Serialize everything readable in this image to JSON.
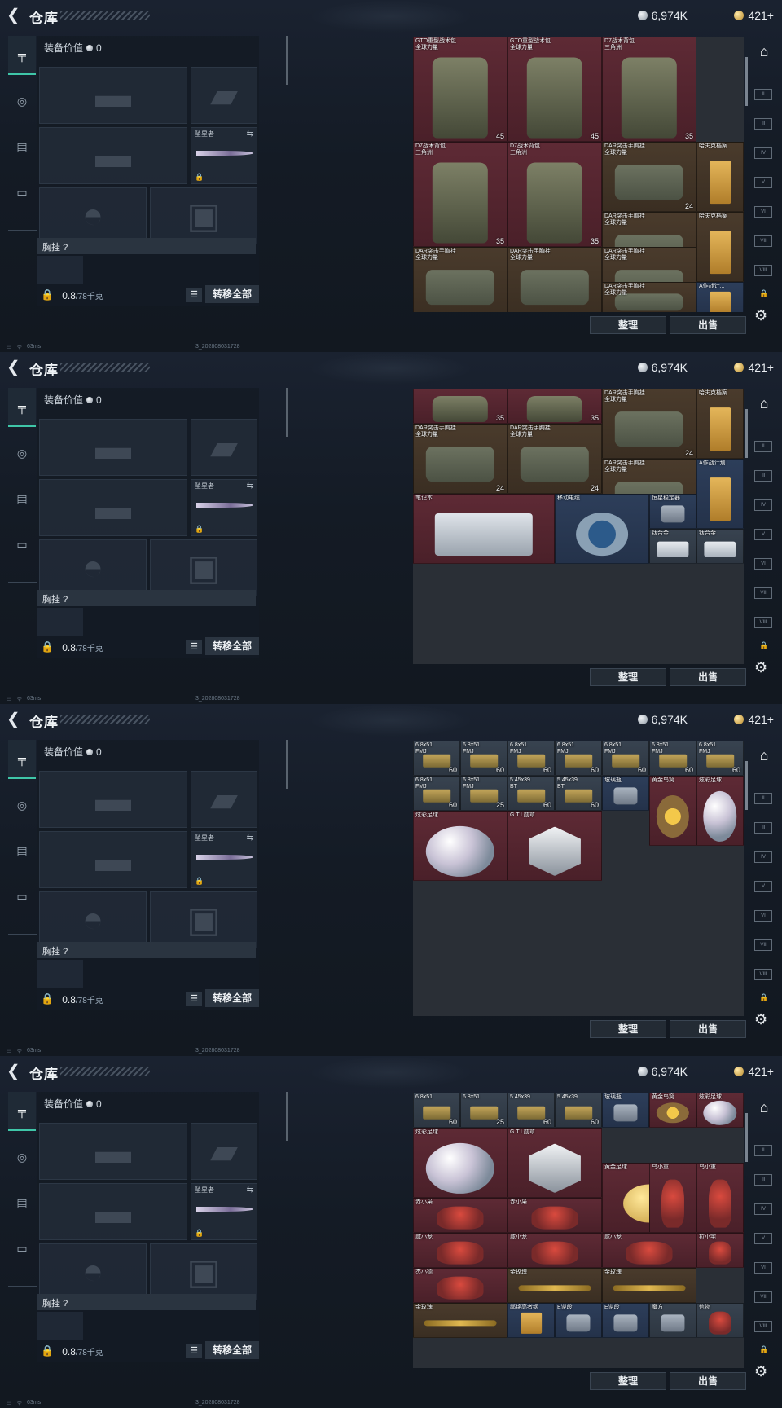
{
  "header": {
    "title": "仓库",
    "silver": "6,974K",
    "gold": "421+"
  },
  "loadout": {
    "equip_value_label": "装备价值",
    "equip_value": "0",
    "knife_label": "坠星者",
    "chest_label": "胸挂",
    "chest_help": "?",
    "weight_current": "0.8",
    "weight_max": "/78千克",
    "transfer_all": "转移全部"
  },
  "inventory_actions": {
    "sort": "整理",
    "sell": "出售"
  },
  "status": {
    "ping": "63ms",
    "build": "3_202808031728"
  },
  "side_tabs": [
    "weapon-tab",
    "helmet-tab",
    "armor-tab",
    "backpack-tab"
  ],
  "screens": [
    {
      "items": [
        {
          "name": "GTO重型战术包\n全球力量",
          "count": "45",
          "kind": "pack",
          "bg": "red",
          "c": 0,
          "r": 0,
          "w": 2,
          "h": 3
        },
        {
          "name": "GTO重型战术包\n全球力量",
          "count": "45",
          "kind": "pack",
          "bg": "red",
          "c": 2,
          "r": 0,
          "w": 2,
          "h": 3
        },
        {
          "name": "D7战术背包\n三角洲",
          "count": "35",
          "kind": "pack",
          "bg": "red",
          "c": 4,
          "r": 0,
          "w": 2,
          "h": 3
        },
        {
          "name": "D7战术背包\n三角洲",
          "count": "35",
          "kind": "pack",
          "bg": "red",
          "c": 0,
          "r": 3,
          "w": 2,
          "h": 3
        },
        {
          "name": "D7战术背包\n三角洲",
          "count": "35",
          "kind": "pack",
          "bg": "red",
          "c": 2,
          "r": 3,
          "w": 2,
          "h": 3
        },
        {
          "name": "DAR突击手胸挂\n全球力量",
          "count": "24",
          "kind": "vest",
          "bg": "brown",
          "c": 4,
          "r": 3,
          "w": 2,
          "h": 2
        },
        {
          "name": "哈夫克档案",
          "count": "",
          "kind": "doc",
          "bg": "brown",
          "c": 6,
          "r": 3,
          "w": 1,
          "h": 2
        },
        {
          "name": "DAR突击手胸挂\n全球力量",
          "count": "24",
          "kind": "vest",
          "bg": "brown",
          "c": 4,
          "r": 5,
          "w": 2,
          "h": 2
        },
        {
          "name": "哈夫克档案",
          "count": "",
          "kind": "doc",
          "bg": "brown",
          "c": 6,
          "r": 5,
          "w": 1,
          "h": 2
        },
        {
          "name": "DAR突击手胸挂\n全球力量",
          "count": "",
          "kind": "vest",
          "bg": "brown",
          "c": 0,
          "r": 6,
          "w": 2,
          "h": 2
        },
        {
          "name": "DAR突击手胸挂\n全球力量",
          "count": "",
          "kind": "vest",
          "bg": "brown",
          "c": 2,
          "r": 6,
          "w": 2,
          "h": 2
        },
        {
          "name": "DAR突击手胸挂\n全球力量",
          "count": "",
          "kind": "vest",
          "bg": "brown",
          "c": 4,
          "r": 6,
          "w": 2,
          "h": 2
        },
        {
          "name": "DAR突击手胸挂\n全球力量",
          "count": "",
          "kind": "vest",
          "bg": "brown",
          "c": 4,
          "r": 7,
          "w": 2,
          "h": 1
        },
        {
          "name": "A作战计...",
          "count": "",
          "kind": "doc",
          "bg": "blue",
          "c": 6,
          "r": 7,
          "w": 1,
          "h": 1
        }
      ]
    },
    {
      "items": [
        {
          "name": "",
          "count": "35",
          "kind": "pack",
          "bg": "red",
          "c": 0,
          "r": 0,
          "w": 2,
          "h": 1
        },
        {
          "name": "",
          "count": "35",
          "kind": "pack",
          "bg": "red",
          "c": 2,
          "r": 0,
          "w": 2,
          "h": 1
        },
        {
          "name": "DAR突击手胸挂\n全球力量",
          "count": "24",
          "kind": "vest",
          "bg": "brown",
          "c": 4,
          "r": 0,
          "w": 2,
          "h": 2
        },
        {
          "name": "哈夫克档案",
          "count": "",
          "kind": "doc",
          "bg": "brown",
          "c": 6,
          "r": 0,
          "w": 1,
          "h": 2
        },
        {
          "name": "DAR突击手胸挂\n全球力量",
          "count": "24",
          "kind": "vest",
          "bg": "brown",
          "c": 0,
          "r": 1,
          "w": 2,
          "h": 2
        },
        {
          "name": "DAR突击手胸挂\n全球力量",
          "count": "24",
          "kind": "vest",
          "bg": "brown",
          "c": 2,
          "r": 1,
          "w": 2,
          "h": 2
        },
        {
          "name": "DAR突击手胸挂\n全球力量",
          "count": "24",
          "kind": "vest",
          "bg": "brown",
          "c": 4,
          "r": 2,
          "w": 2,
          "h": 2
        },
        {
          "name": "A作战计划",
          "count": "",
          "kind": "doc",
          "bg": "blue",
          "c": 6,
          "r": 2,
          "w": 1,
          "h": 2
        },
        {
          "name": "笔记本",
          "count": "",
          "kind": "laptop",
          "bg": "red",
          "c": 0,
          "r": 3,
          "w": 3,
          "h": 2
        },
        {
          "name": "移动电缆",
          "count": "",
          "kind": "reel",
          "bg": "blue",
          "c": 3,
          "r": 3,
          "w": 2,
          "h": 2
        },
        {
          "name": "恒星稳定器",
          "count": "",
          "kind": "small",
          "bg": "blue",
          "c": 5,
          "r": 3,
          "w": 1,
          "h": 1
        },
        {
          "name": "钛合金",
          "count": "",
          "kind": "plate",
          "bg": "gray",
          "c": 5,
          "r": 4,
          "w": 1,
          "h": 1
        },
        {
          "name": "钛合金",
          "count": "",
          "kind": "plate",
          "bg": "gray",
          "c": 6,
          "r": 4,
          "w": 1,
          "h": 1
        }
      ]
    },
    {
      "items": [
        {
          "name": "6.8x51\nFMJ",
          "count": "60",
          "kind": "ammo",
          "bg": "gray",
          "c": 0,
          "r": 0,
          "w": 1,
          "h": 1
        },
        {
          "name": "6.8x51\nFMJ",
          "count": "60",
          "kind": "ammo",
          "bg": "gray",
          "c": 1,
          "r": 0,
          "w": 1,
          "h": 1
        },
        {
          "name": "6.8x51\nFMJ",
          "count": "60",
          "kind": "ammo",
          "bg": "gray",
          "c": 2,
          "r": 0,
          "w": 1,
          "h": 1
        },
        {
          "name": "6.8x51\nFMJ",
          "count": "60",
          "kind": "ammo",
          "bg": "gray",
          "c": 3,
          "r": 0,
          "w": 1,
          "h": 1
        },
        {
          "name": "6.8x51\nFMJ",
          "count": "60",
          "kind": "ammo",
          "bg": "gray",
          "c": 4,
          "r": 0,
          "w": 1,
          "h": 1
        },
        {
          "name": "6.8x51\nFMJ",
          "count": "60",
          "kind": "ammo",
          "bg": "gray",
          "c": 5,
          "r": 0,
          "w": 1,
          "h": 1
        },
        {
          "name": "6.8x51\nFMJ",
          "count": "60",
          "kind": "ammo",
          "bg": "gray",
          "c": 6,
          "r": 0,
          "w": 1,
          "h": 1
        },
        {
          "name": "6.8x51\nFMJ",
          "count": "60",
          "kind": "ammo",
          "bg": "gray",
          "c": 0,
          "r": 1,
          "w": 1,
          "h": 1
        },
        {
          "name": "6.8x51\nFMJ",
          "count": "25",
          "kind": "ammo",
          "bg": "gray",
          "c": 1,
          "r": 1,
          "w": 1,
          "h": 1
        },
        {
          "name": "5.45x39\nBT",
          "count": "60",
          "kind": "ammo",
          "bg": "gray",
          "c": 2,
          "r": 1,
          "w": 1,
          "h": 1
        },
        {
          "name": "5.45x39\nBT",
          "count": "60",
          "kind": "ammo",
          "bg": "gray",
          "c": 3,
          "r": 1,
          "w": 1,
          "h": 1
        },
        {
          "name": "玻璃瓶",
          "count": "",
          "kind": "small",
          "bg": "blue",
          "c": 4,
          "r": 1,
          "w": 1,
          "h": 1
        },
        {
          "name": "黄金鸟窝",
          "count": "",
          "kind": "nest",
          "bg": "red",
          "c": 5,
          "r": 1,
          "w": 1,
          "h": 2
        },
        {
          "name": "炫彩足球",
          "count": "",
          "kind": "orb",
          "bg": "red",
          "c": 6,
          "r": 1,
          "w": 1,
          "h": 2
        },
        {
          "name": "炫彩足球",
          "count": "",
          "kind": "orb",
          "bg": "red",
          "c": 0,
          "r": 2,
          "w": 2,
          "h": 2
        },
        {
          "name": "G.T.I.勋章",
          "count": "",
          "kind": "badge",
          "bg": "red",
          "c": 2,
          "r": 2,
          "w": 2,
          "h": 2
        }
      ]
    },
    {
      "items": [
        {
          "name": "6.8x51",
          "count": "60",
          "kind": "ammo",
          "bg": "gray",
          "c": 0,
          "r": 0,
          "w": 1,
          "h": 1
        },
        {
          "name": "6.8x51",
          "count": "25",
          "kind": "ammo",
          "bg": "gray",
          "c": 1,
          "r": 0,
          "w": 1,
          "h": 1
        },
        {
          "name": "5.45x39",
          "count": "60",
          "kind": "ammo",
          "bg": "gray",
          "c": 2,
          "r": 0,
          "w": 1,
          "h": 1
        },
        {
          "name": "5.45x39",
          "count": "60",
          "kind": "ammo",
          "bg": "gray",
          "c": 3,
          "r": 0,
          "w": 1,
          "h": 1
        },
        {
          "name": "玻璃瓶",
          "count": "",
          "kind": "small",
          "bg": "blue",
          "c": 4,
          "r": 0,
          "w": 1,
          "h": 1
        },
        {
          "name": "黄金鸟窝",
          "count": "",
          "kind": "nest",
          "bg": "red",
          "c": 5,
          "r": 0,
          "w": 1,
          "h": 1
        },
        {
          "name": "炫彩足球",
          "count": "",
          "kind": "orb",
          "bg": "red",
          "c": 6,
          "r": 0,
          "w": 1,
          "h": 1
        },
        {
          "name": "炫彩足球",
          "count": "",
          "kind": "orb",
          "bg": "red",
          "c": 0,
          "r": 1,
          "w": 2,
          "h": 2
        },
        {
          "name": "G.T.I.勋章",
          "count": "",
          "kind": "badge",
          "bg": "red",
          "c": 2,
          "r": 1,
          "w": 2,
          "h": 2
        },
        {
          "name": "黄金足球",
          "count": "",
          "kind": "gold",
          "bg": "red",
          "c": 4,
          "r": 2,
          "w": 2,
          "h": 2
        },
        {
          "name": "乌小重",
          "count": "",
          "kind": "toy",
          "bg": "red",
          "c": 5,
          "r": 2,
          "w": 1,
          "h": 2
        },
        {
          "name": "乌小重",
          "count": "",
          "kind": "toy",
          "bg": "red",
          "c": 6,
          "r": 2,
          "w": 1,
          "h": 2
        },
        {
          "name": "赤小枭",
          "count": "",
          "kind": "toy",
          "bg": "red",
          "c": 0,
          "r": 3,
          "w": 2,
          "h": 1
        },
        {
          "name": "赤小枭",
          "count": "",
          "kind": "toy",
          "bg": "red",
          "c": 2,
          "r": 3,
          "w": 2,
          "h": 1
        },
        {
          "name": "咸小龙",
          "count": "",
          "kind": "toy",
          "bg": "red",
          "c": 0,
          "r": 4,
          "w": 2,
          "h": 1
        },
        {
          "name": "咸小龙",
          "count": "",
          "kind": "toy",
          "bg": "red",
          "c": 2,
          "r": 4,
          "w": 2,
          "h": 1
        },
        {
          "name": "咸小龙",
          "count": "",
          "kind": "toy",
          "bg": "red",
          "c": 4,
          "r": 4,
          "w": 2,
          "h": 1
        },
        {
          "name": "拉小宅",
          "count": "",
          "kind": "toy",
          "bg": "red",
          "c": 6,
          "r": 4,
          "w": 1,
          "h": 1
        },
        {
          "name": "杰小德",
          "count": "",
          "kind": "toy",
          "bg": "red",
          "c": 0,
          "r": 5,
          "w": 2,
          "h": 1
        },
        {
          "name": "金玫瑰",
          "count": "",
          "kind": "rose",
          "bg": "brown",
          "c": 2,
          "r": 5,
          "w": 2,
          "h": 1
        },
        {
          "name": "金玫瑰",
          "count": "",
          "kind": "rose",
          "bg": "brown",
          "c": 4,
          "r": 5,
          "w": 2,
          "h": 1
        },
        {
          "name": "金玫瑰",
          "count": "",
          "kind": "rose",
          "bg": "brown",
          "c": 0,
          "r": 6,
          "w": 2,
          "h": 1
        },
        {
          "name": "鄙锦高者纲",
          "count": "",
          "kind": "doc",
          "bg": "blue",
          "c": 2,
          "r": 6,
          "w": 1,
          "h": 1
        },
        {
          "name": "E逆段",
          "count": "",
          "kind": "small",
          "bg": "blue",
          "c": 3,
          "r": 6,
          "w": 1,
          "h": 1
        },
        {
          "name": "E逆段",
          "count": "",
          "kind": "small",
          "bg": "blue",
          "c": 4,
          "r": 6,
          "w": 1,
          "h": 1
        },
        {
          "name": "魔方",
          "count": "",
          "kind": "small",
          "bg": "gray",
          "c": 5,
          "r": 6,
          "w": 1,
          "h": 1
        },
        {
          "name": "信物",
          "count": "",
          "kind": "toy",
          "bg": "gray",
          "c": 6,
          "r": 6,
          "w": 1,
          "h": 1
        }
      ]
    }
  ]
}
